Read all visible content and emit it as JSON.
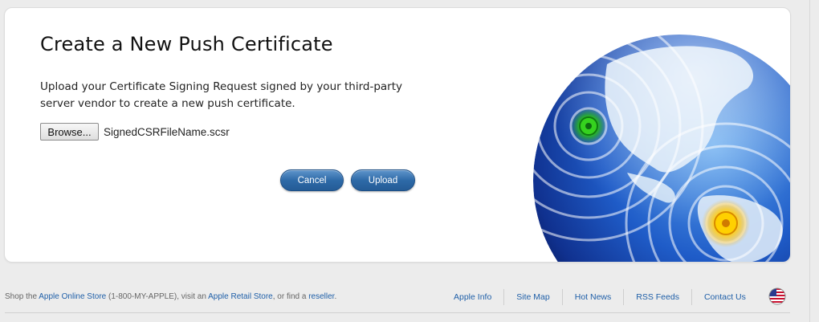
{
  "main": {
    "title": "Create a New Push Certificate",
    "description": "Upload your Certificate Signing Request signed by your third-party server vendor to create a new push certificate.",
    "browse_label": "Browse...",
    "file_name": "SignedCSRFileName.scsr",
    "cancel_label": "Cancel",
    "upload_label": "Upload"
  },
  "footer": {
    "shop_prefix": "Shop the ",
    "online_store": "Apple Online Store",
    "phone": " (1-800-MY-APPLE), visit an ",
    "retail_store": "Apple Retail Store",
    "or_find": ", or find a ",
    "reseller": "reseller",
    "period": ".",
    "links": [
      "Apple Info",
      "Site Map",
      "Hot News",
      "RSS Feeds",
      "Contact Us"
    ]
  },
  "icons": {
    "globe": "globe-illustration",
    "flag": "us-flag-icon"
  },
  "colors": {
    "button_blue": "#2e6aa8",
    "link_blue": "#1f5fa8",
    "green_pin": "#2bc21a",
    "yellow_pin": "#f4c400"
  }
}
